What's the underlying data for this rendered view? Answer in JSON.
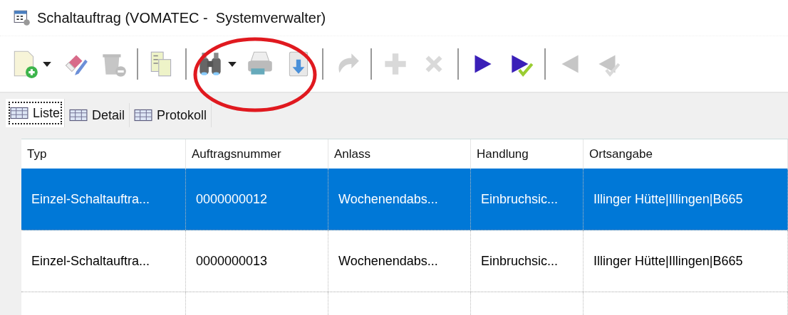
{
  "window": {
    "title": "Schaltauftrag (VOMATEC -  Systemverwalter)"
  },
  "toolbar": {
    "groups": [
      [
        {
          "disabled": false,
          "dropdown": true
        },
        {
          "disabled": false,
          "dropdown": false
        },
        {
          "disabled": true,
          "dropdown": false
        }
      ],
      [
        {
          "disabled": false,
          "dropdown": false
        }
      ],
      [
        {
          "disabled": false,
          "dropdown": true
        },
        {
          "disabled": false,
          "dropdown": false
        },
        {
          "disabled": false,
          "dropdown": false
        }
      ],
      [
        {
          "disabled": true,
          "dropdown": false
        }
      ],
      [
        {
          "disabled": true,
          "dropdown": false
        },
        {
          "disabled": true,
          "dropdown": false
        }
      ],
      [
        {
          "disabled": false,
          "dropdown": false
        },
        {
          "disabled": false,
          "dropdown": false
        }
      ],
      [
        {
          "disabled": true,
          "dropdown": false
        },
        {
          "disabled": true,
          "dropdown": false
        }
      ]
    ]
  },
  "tabs": [
    {
      "label": "Liste",
      "selected": true
    },
    {
      "label": "Detail",
      "selected": false
    },
    {
      "label": "Protokoll",
      "selected": false
    }
  ],
  "table": {
    "columns": [
      "Typ",
      "Auftragsnummer",
      "Anlass",
      "Handlung",
      "Ortsangabe"
    ],
    "rows": [
      {
        "selected": true,
        "cells": [
          "Einzel-Schaltauftra...",
          "0000000012",
          "Wochenendabs...",
          "Einbruchsic...",
          "Illinger  Hütte|Illingen|B665"
        ]
      },
      {
        "selected": false,
        "cells": [
          "Einzel-Schaltauftra...",
          "0000000013",
          "Wochenendabs...",
          "Einbruchsic...",
          "Illinger  Hütte|Illingen|B665"
        ]
      }
    ]
  }
}
